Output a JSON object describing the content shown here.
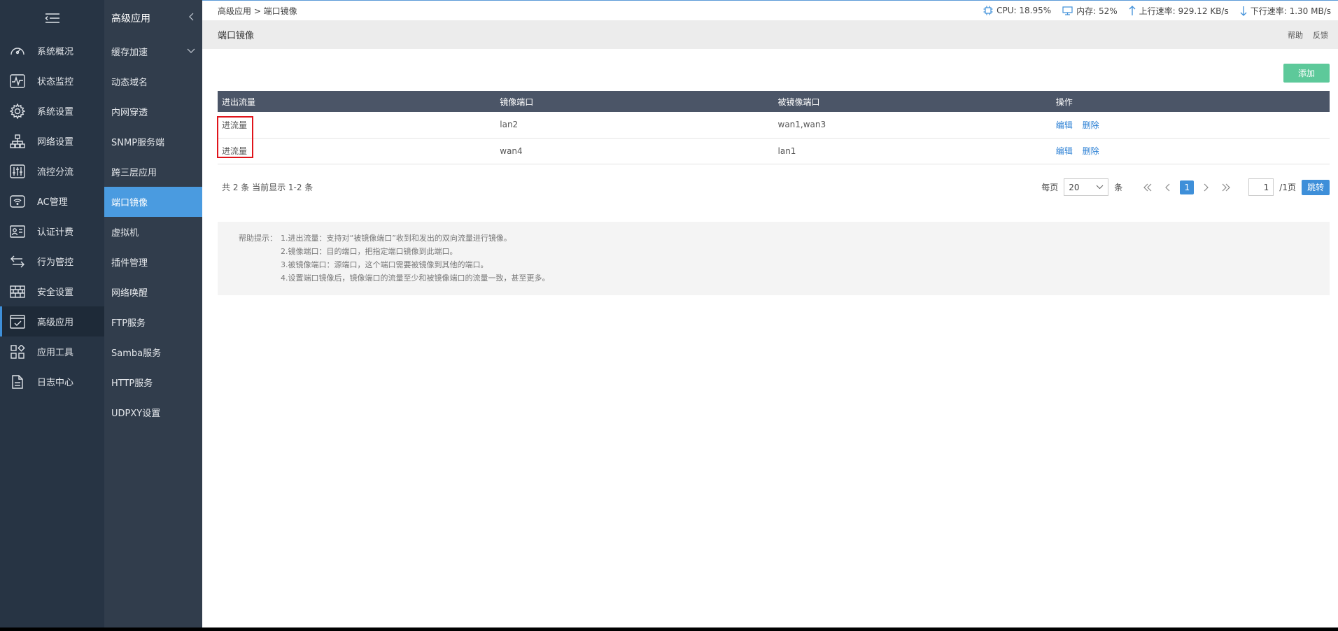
{
  "sidebar": {
    "items": [
      {
        "label": "系统概况",
        "icon": "dashboard-gauge-icon"
      },
      {
        "label": "状态监控",
        "icon": "pulse-monitor-icon"
      },
      {
        "label": "系统设置",
        "icon": "gear-icon"
      },
      {
        "label": "网络设置",
        "icon": "network-tree-icon"
      },
      {
        "label": "流控分流",
        "icon": "sliders-icon"
      },
      {
        "label": "AC管理",
        "icon": "wifi-router-icon"
      },
      {
        "label": "认证计费",
        "icon": "id-card-icon"
      },
      {
        "label": "行为管控",
        "icon": "arrows-exchange-icon"
      },
      {
        "label": "安全设置",
        "icon": "firewall-icon"
      },
      {
        "label": "高级应用",
        "icon": "checklist-icon",
        "active": true
      },
      {
        "label": "应用工具",
        "icon": "apps-grid-icon"
      },
      {
        "label": "日志中心",
        "icon": "document-icon"
      }
    ]
  },
  "subnav": {
    "title": "高级应用",
    "items": [
      {
        "label": "缓存加速",
        "has_arrow": true
      },
      {
        "label": "动态域名"
      },
      {
        "label": "内网穿透"
      },
      {
        "label": "SNMP服务端"
      },
      {
        "label": "跨三层应用"
      },
      {
        "label": "端口镜像",
        "active": true
      },
      {
        "label": "虚拟机"
      },
      {
        "label": "插件管理"
      },
      {
        "label": "网络唤醒"
      },
      {
        "label": "FTP服务"
      },
      {
        "label": "Samba服务"
      },
      {
        "label": "HTTP服务"
      },
      {
        "label": "UDPXY设置"
      }
    ]
  },
  "breadcrumb": "高级应用 > 端口镜像",
  "stats": {
    "cpu": "CPU: 18.95%",
    "mem": "内存: 52%",
    "up": "上行速率: 929.12 KB/s",
    "down": "下行速率: 1.30 MB/s"
  },
  "page": {
    "title": "端口镜像",
    "help_link": "帮助",
    "feedback_link": "反馈",
    "add_button": "添加"
  },
  "table": {
    "headers": [
      "进出流量",
      "镜像端口",
      "被镜像端口",
      "操作"
    ],
    "rows": [
      {
        "direction": "进流量",
        "mirror": "lan2",
        "mirrored": "wan1,wan3"
      },
      {
        "direction": "进流量",
        "mirror": "wan4",
        "mirrored": "lan1"
      }
    ],
    "edit_label": "编辑",
    "delete_label": "删除"
  },
  "pager": {
    "summary": "共 2 条 当前显示 1-2 条",
    "per_page_label": "每页",
    "per_page_value": "20",
    "unit": "条",
    "current_page": "1",
    "page_input": "1",
    "total_pages": "/1页",
    "jump_button": "跳转"
  },
  "help": {
    "label": "帮助提示：",
    "lines": [
      "1.进出流量：支持对“被镜像端口”收到和发出的双向流量进行镜像。",
      "2.镜像端口：目的端口，把指定端口镜像到此端口。",
      "3.被镜像端口：源端口，这个端口需要被镜像到其他的端口。",
      "4.设置端口镜像后，镜像端口的流量至少和被镜像端口的流量一致，甚至更多。"
    ]
  },
  "colors": {
    "accent": "#4a9be0",
    "add_button": "#5dc99a",
    "highlight_box": "#e0141b"
  }
}
